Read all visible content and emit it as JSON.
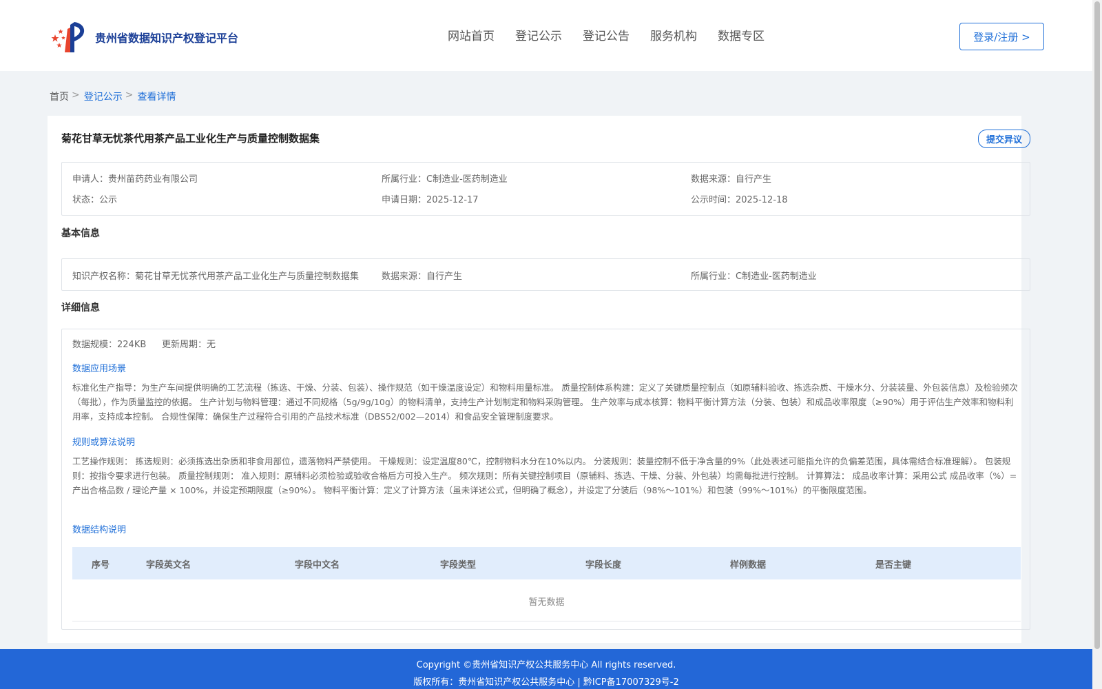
{
  "header": {
    "brand": "贵州省数据知识产权登记平台",
    "nav": [
      "网站首页",
      "登记公示",
      "登记公告",
      "服务机构",
      "数据专区"
    ],
    "login_label": "登录/注册 >"
  },
  "breadcrumb": {
    "home": "首页",
    "separator": ">",
    "items": [
      "登记公示",
      "查看详情"
    ]
  },
  "detail": {
    "title": "菊花甘草无忧茶代用茶产品工业化生产与质量控制数据集",
    "objection_label": "提交异议",
    "meta": {
      "applicant_label": "申请人：",
      "applicant": "贵州苗药药业有限公司",
      "industry_label": "所属行业：",
      "industry": "C制造业-医药制造业",
      "source_label": "数据来源：",
      "source": "自行产生",
      "status_label": "状态：",
      "status": "公示",
      "apply_date_label": "申请日期：",
      "apply_date": "2025-12-17",
      "publish_date_label": "公示时间：",
      "publish_date": "2025-12-18"
    }
  },
  "basic": {
    "heading": "基本信息",
    "ip_name_label": "知识产权名称：",
    "ip_name": "菊花甘草无忧茶代用茶产品工业化生产与质量控制数据集",
    "source_label": "数据来源：",
    "source": "自行产生",
    "industry_label": "所属行业：",
    "industry": "C制造业-医药制造业"
  },
  "details": {
    "heading": "详细信息",
    "scale_label": "数据规模：",
    "scale": "224KB",
    "cycle_label": "更新周期：",
    "cycle": "无",
    "scenario_title": "数据应用场景",
    "scenario_text": "标准化生产指导：为生产车间提供明确的工艺流程（拣选、干燥、分装、包装）、操作规范（如干燥温度设定）和物料用量标准。 质量控制体系构建：定义了关键质量控制点（如原辅料验收、拣选杂质、干燥水分、分装装量、外包装信息）及检验频次（每批），作为质量监控的依据。 生产计划与物料管理：通过不同规格（5g/9g/10g）的物料清单，支持生产计划制定和物料采购管理。 生产效率与成本核算：物料平衡计算方法（分装、包装）和成品收率限度（≥90%）用于评估生产效率和物料利用率，支持成本控制。 合规性保障：确保生产过程符合引用的产品技术标准（DBS52/002—2014）和食品安全管理制度要求。",
    "rules_title": "规则或算法说明",
    "rules_text": "工艺操作规则： 拣选规则：必须拣选出杂质和非食用部位，遗落物料严禁使用。 干燥规则：设定温度80℃，控制物料水分在10%以内。 分装规则：装量控制不低于净含量的9%（此处表述可能指允许的负偏差范围，具体需结合标准理解）。 包装规则：按指令要求进行包装。 质量控制规则： 准入规则：原辅料必须检验或验收合格后方可投入生产。 频次规则：所有关键控制项目（原辅料、拣选、干燥、分装、外包装）均需每批进行控制。 计算算法： 成品收率计算：采用公式 成品收率（%）= 产出合格品数 / 理论产量 × 100%，并设定预期限度（≥90%）。 物料平衡计算：定义了计算方法（虽未详述公式，但明确了概念），并设定了分装后（98%～101%）和包装（99%～101%）的平衡限度范围。",
    "structure_title": "数据结构说明",
    "table_columns": [
      "序号",
      "字段英文名",
      "字段中文名",
      "字段类型",
      "字段长度",
      "样例数据",
      "是否主键"
    ],
    "empty_text": "暂无数据"
  },
  "footer": {
    "copyright": "Copyright ©贵州省知识产权公共服务中心 All rights reserved.",
    "owner": "版权所有：贵州省知识产权公共服务中心 | 黔ICP备17007329号-2"
  },
  "colors": {
    "brand": "#1b3f97",
    "accent": "#1f6fd8",
    "footer": "#2367d7",
    "table_head": "#e1edfc"
  },
  "icons": [
    "logo-icon"
  ]
}
